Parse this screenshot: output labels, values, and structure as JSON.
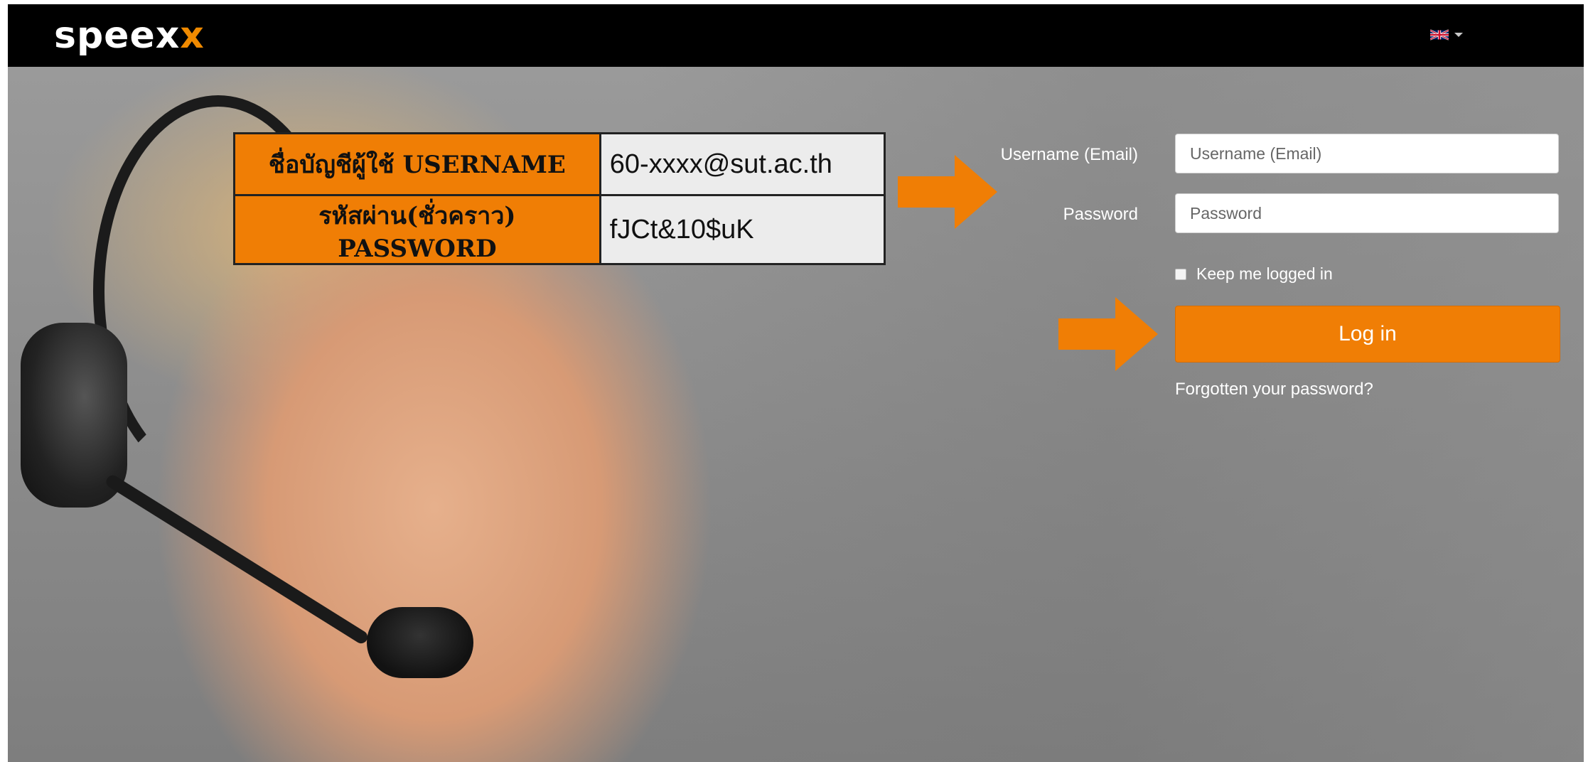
{
  "header": {
    "logo_main": "speex",
    "logo_accent": "x",
    "language": "flag-uk-icon"
  },
  "overlay": {
    "rows": [
      {
        "label": "ชื่อบัญชีผู้ใช้ USERNAME",
        "value": "60-xxxx@sut.ac.th"
      },
      {
        "label": "รหัสผ่าน(ชั่วคราว) PASSWORD",
        "value": "fJCt&10$uK"
      }
    ],
    "arrow_color": "#f07e05"
  },
  "login": {
    "username_label": "Username (Email)",
    "username_placeholder": "Username (Email)",
    "password_label": "Password",
    "password_placeholder": "Password",
    "keep_logged_in": "Keep me logged in",
    "button_label": "Log in",
    "forgot_link": "Forgotten your password?"
  },
  "colors": {
    "accent": "#f07e05",
    "topbar": "#000000"
  }
}
